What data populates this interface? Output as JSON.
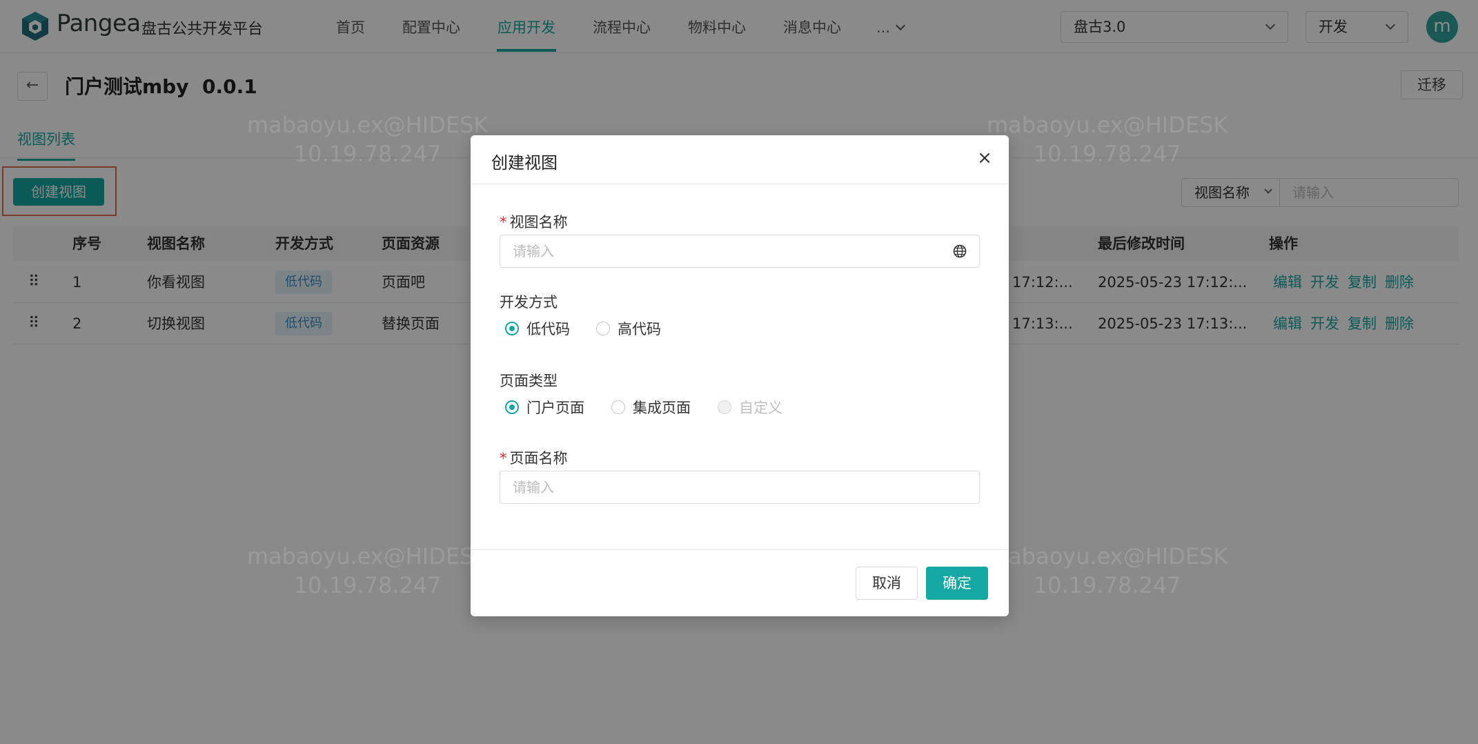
{
  "header": {
    "brand": "Pangea",
    "platform": "盘古公共开发平台",
    "nav": [
      "首页",
      "配置中心",
      "应用开发",
      "流程中心",
      "物料中心",
      "消息中心",
      "..."
    ],
    "active_nav": "应用开发",
    "version_select": "盘古3.0",
    "env_select": "开发",
    "avatar_letter": "m"
  },
  "page": {
    "back_icon": "←",
    "title": "门户测试mby  0.0.1",
    "migrate_label": "迁移",
    "tab": "视图列表",
    "create_label": "创建视图",
    "filter_field": "视图名称",
    "filter_placeholder": "请输入"
  },
  "table": {
    "columns": [
      "序号",
      "视图名称",
      "开发方式",
      "页面资源",
      "最后修改时间",
      "操作"
    ],
    "rows": [
      {
        "index": "1",
        "name": "你看视图",
        "dev_mode": "低代码",
        "resource": "页面吧",
        "created_partial": "17:12:...",
        "modified": "2025-05-23 17:12:..."
      },
      {
        "index": "2",
        "name": "切换视图",
        "dev_mode": "低代码",
        "resource": "替换页面",
        "created_partial": "17:13:...",
        "modified": "2025-05-23 17:13:..."
      }
    ],
    "actions": [
      "编辑",
      "开发",
      "复制",
      "删除"
    ]
  },
  "watermark": {
    "line1": "mabaoyu.ex@HIDESK",
    "line2": "10.19.78.247"
  },
  "modal": {
    "title": "创建视图",
    "close": "×",
    "required_mark": "*",
    "view_name_label": "视图名称",
    "view_name_placeholder": "请输入",
    "dev_mode_label": "开发方式",
    "dev_mode_options": [
      "低代码",
      "高代码"
    ],
    "page_type_label": "页面类型",
    "page_type_options": [
      "门户页面",
      "集成页面",
      "自定义"
    ],
    "page_name_label": "页面名称",
    "page_name_placeholder": "请输入",
    "cancel": "取消",
    "ok": "确定"
  },
  "colors": {
    "primary": "#13a8a3",
    "tag_bg": "#e6f4fb",
    "tag_text": "#3b8fc9",
    "highlight": "#e06a4a"
  }
}
